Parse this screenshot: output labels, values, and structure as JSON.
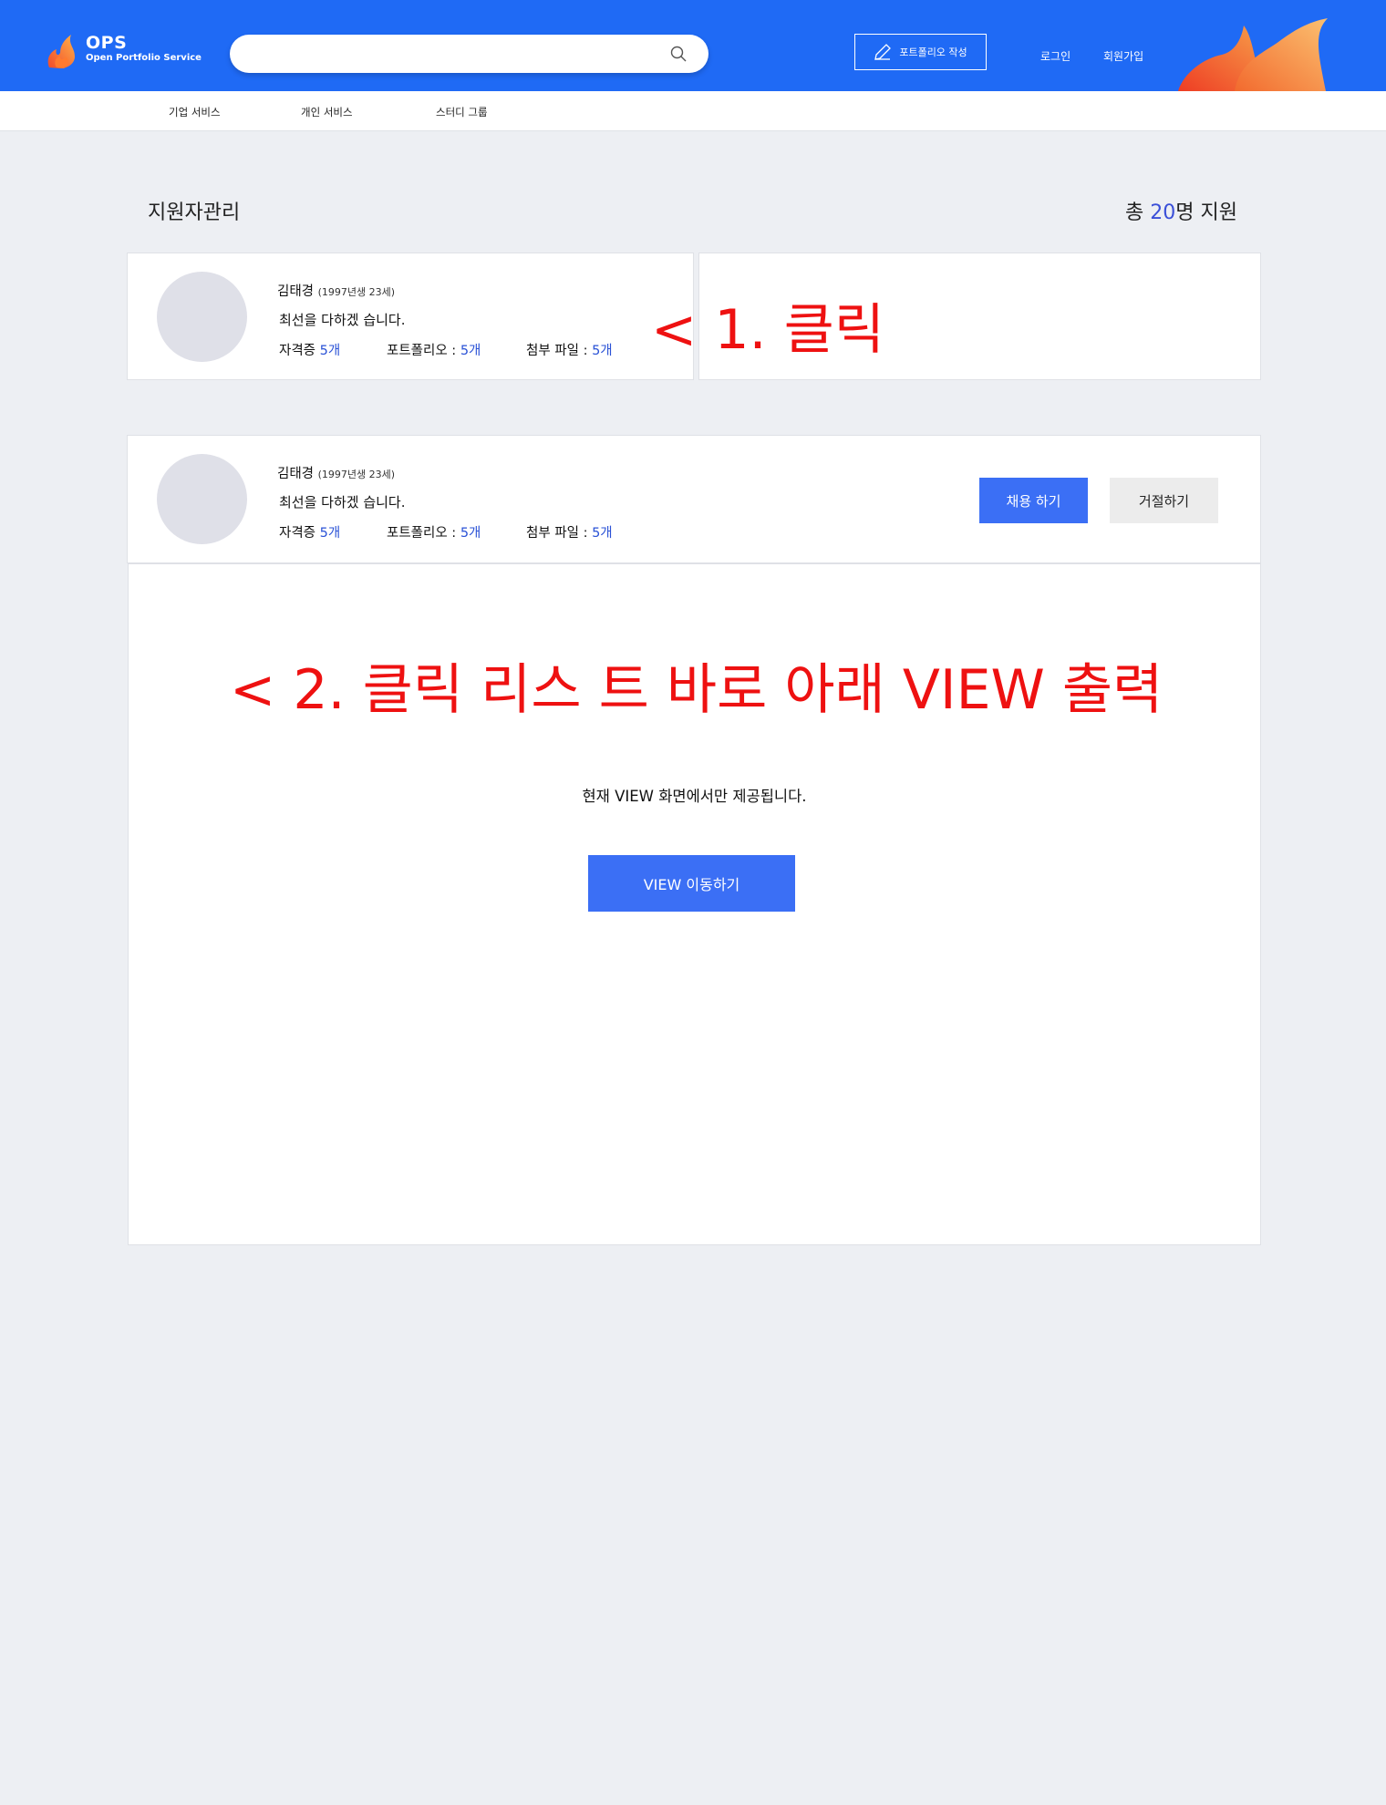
{
  "header": {
    "logo_title": "OPS",
    "logo_subtitle": "Open Portfolio Service",
    "search_placeholder": "",
    "write_button": "포트폴리오 작성",
    "login": "로그인",
    "signup": "회원가입",
    "brand_color": "#1f6af5"
  },
  "subnav": [
    "기업 서비스",
    "개인 서비스",
    "스터디 그룹"
  ],
  "page": {
    "title": "지원자관리",
    "total_prefix": "총 ",
    "total_count": "20",
    "total_suffix": "명 지원"
  },
  "applicants": [
    {
      "name": "김태경",
      "meta": "(1997년생 23세)",
      "motto": "최선을 다하겠 습니다.",
      "cert_label": "자격증 ",
      "cert_value": "5개",
      "portfolio_label": "포트폴리오 : ",
      "portfolio_value": "5개",
      "file_label": "첨부 파일 : ",
      "file_value": "5개"
    },
    {
      "name": "김태경",
      "meta": "(1997년생 23세)",
      "motto": "최선을 다하겠 습니다.",
      "cert_label": "자격증 ",
      "cert_value": "5개",
      "portfolio_label": "포트폴리오 : ",
      "portfolio_value": "5개",
      "file_label": "첨부 파일 : ",
      "file_value": "5개"
    }
  ],
  "actions": {
    "hire": "채용 하기",
    "reject": "거절하기"
  },
  "annotations": {
    "step1": "< 1. 클릭",
    "step2": "< 2. 클릭 리스 트 바로 아래 VIEW 출력"
  },
  "view": {
    "message": "현재 VIEW 화면에서만 제공됩니다.",
    "button": "VIEW 이동하기"
  },
  "colors": {
    "accent": "#3b6ff5",
    "link_value": "#2a52d6",
    "annotation": "#ee1111",
    "background": "#edeff3"
  },
  "icons": [
    "logo-flame-icon",
    "search-icon",
    "pencil-icon",
    "header-flame-decoration"
  ]
}
